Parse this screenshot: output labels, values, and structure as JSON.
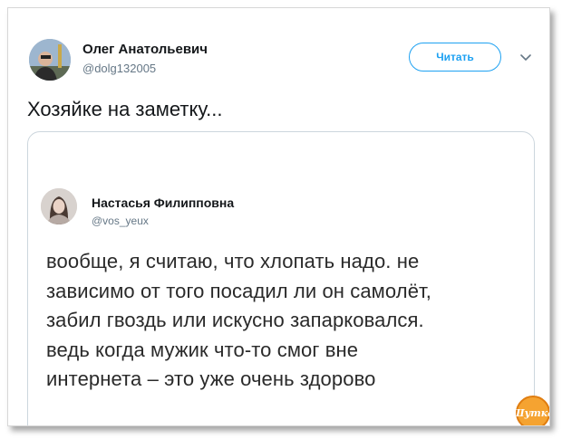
{
  "tweet": {
    "author_name": "Олег Анатольевич",
    "author_handle": "@dolg132005",
    "follow_label": "Читать",
    "text": "Хозяйке на заметку..."
  },
  "quoted": {
    "author_name": "Настасья Филипповна",
    "author_handle": "@vos_yeux",
    "text": "вообще, я считаю, что хлопать надо. не\nзависимо от того посадил ли он самолёт,\nзабил гвоздь или искусно запарковался.\nведь когда мужик что-то смог вне\nинтернета – это уже очень здорово"
  },
  "watermark": {
    "text": "Шутка"
  },
  "colors": {
    "accent": "#1da1f2",
    "handle": "#657786",
    "border": "#ccd6dd"
  }
}
